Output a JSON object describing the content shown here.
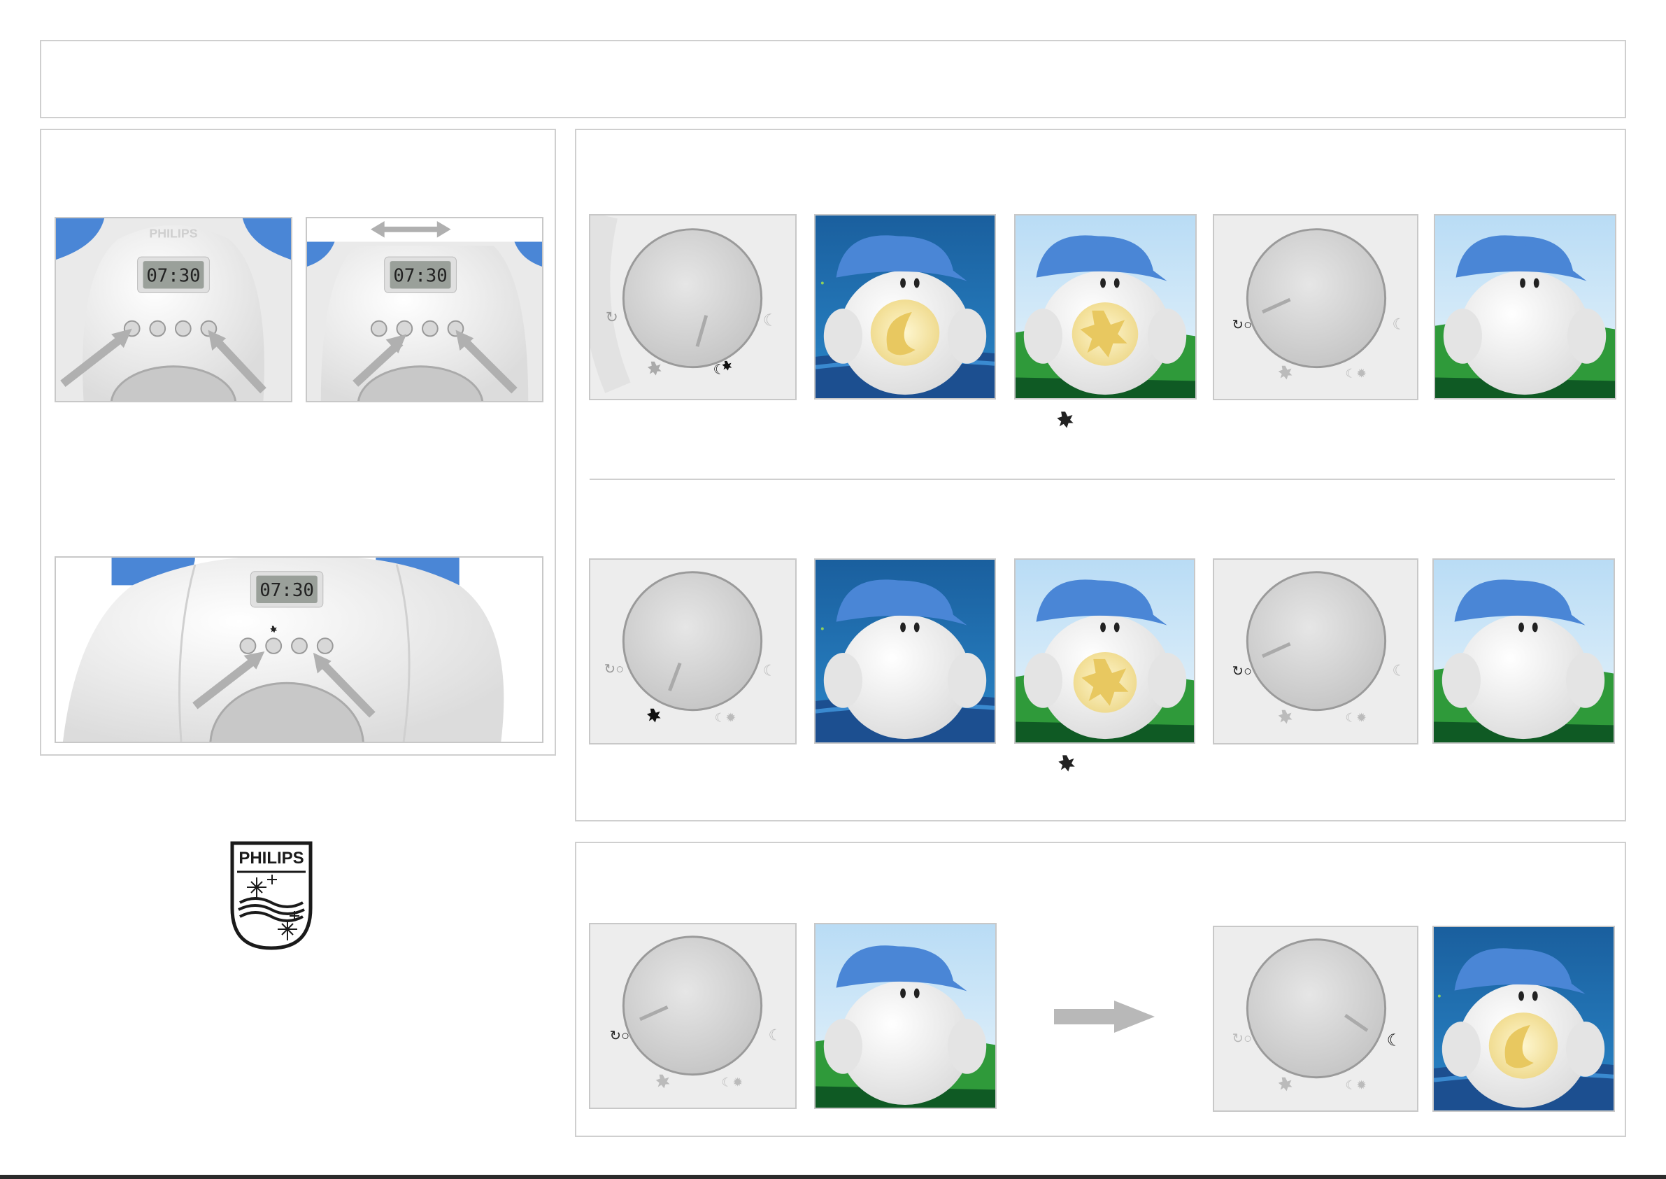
{
  "brand": {
    "name": "PHILIPS"
  },
  "display": {
    "time": "07:30"
  },
  "icons": {
    "double_arrow": "double-arrow-icon",
    "arrow_right": "arrow-right-icon",
    "sun": "sun-icon",
    "moon": "moon-icon",
    "moon_sun": "moon-sun-icon",
    "timer_off": "timer-off-icon"
  },
  "colors": {
    "cap_blue": "#4a86d6",
    "sky_dark": "#1e6fb0",
    "sky_light": "#cfe8f8",
    "grass": "#2f9a3a",
    "glow": "#f4e4a0",
    "arrow_gray": "#b8b8b8"
  }
}
